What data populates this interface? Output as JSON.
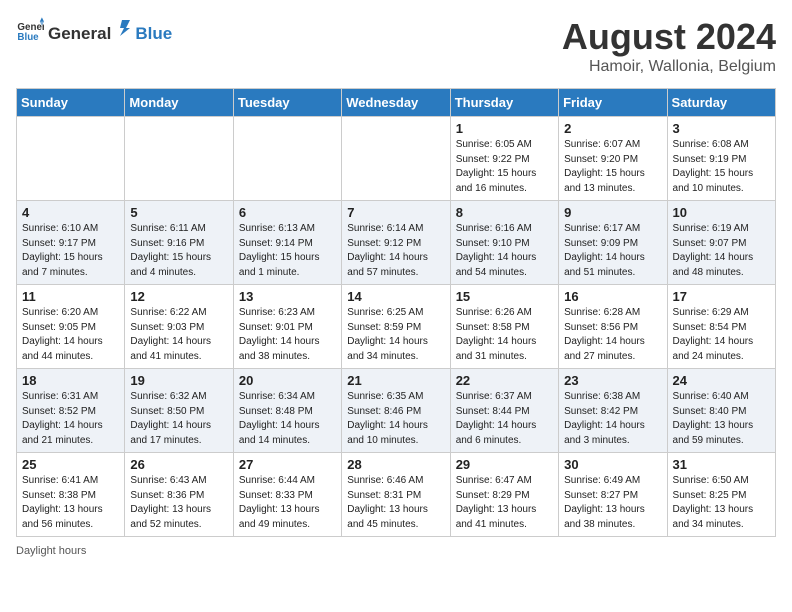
{
  "header": {
    "logo_general": "General",
    "logo_blue": "Blue",
    "title": "August 2024",
    "subtitle": "Hamoir, Wallonia, Belgium"
  },
  "columns": [
    "Sunday",
    "Monday",
    "Tuesday",
    "Wednesday",
    "Thursday",
    "Friday",
    "Saturday"
  ],
  "rows": [
    [
      {
        "day": "",
        "info": ""
      },
      {
        "day": "",
        "info": ""
      },
      {
        "day": "",
        "info": ""
      },
      {
        "day": "",
        "info": ""
      },
      {
        "day": "1",
        "info": "Sunrise: 6:05 AM\nSunset: 9:22 PM\nDaylight: 15 hours and 16 minutes."
      },
      {
        "day": "2",
        "info": "Sunrise: 6:07 AM\nSunset: 9:20 PM\nDaylight: 15 hours and 13 minutes."
      },
      {
        "day": "3",
        "info": "Sunrise: 6:08 AM\nSunset: 9:19 PM\nDaylight: 15 hours and 10 minutes."
      }
    ],
    [
      {
        "day": "4",
        "info": "Sunrise: 6:10 AM\nSunset: 9:17 PM\nDaylight: 15 hours and 7 minutes."
      },
      {
        "day": "5",
        "info": "Sunrise: 6:11 AM\nSunset: 9:16 PM\nDaylight: 15 hours and 4 minutes."
      },
      {
        "day": "6",
        "info": "Sunrise: 6:13 AM\nSunset: 9:14 PM\nDaylight: 15 hours and 1 minute."
      },
      {
        "day": "7",
        "info": "Sunrise: 6:14 AM\nSunset: 9:12 PM\nDaylight: 14 hours and 57 minutes."
      },
      {
        "day": "8",
        "info": "Sunrise: 6:16 AM\nSunset: 9:10 PM\nDaylight: 14 hours and 54 minutes."
      },
      {
        "day": "9",
        "info": "Sunrise: 6:17 AM\nSunset: 9:09 PM\nDaylight: 14 hours and 51 minutes."
      },
      {
        "day": "10",
        "info": "Sunrise: 6:19 AM\nSunset: 9:07 PM\nDaylight: 14 hours and 48 minutes."
      }
    ],
    [
      {
        "day": "11",
        "info": "Sunrise: 6:20 AM\nSunset: 9:05 PM\nDaylight: 14 hours and 44 minutes."
      },
      {
        "day": "12",
        "info": "Sunrise: 6:22 AM\nSunset: 9:03 PM\nDaylight: 14 hours and 41 minutes."
      },
      {
        "day": "13",
        "info": "Sunrise: 6:23 AM\nSunset: 9:01 PM\nDaylight: 14 hours and 38 minutes."
      },
      {
        "day": "14",
        "info": "Sunrise: 6:25 AM\nSunset: 8:59 PM\nDaylight: 14 hours and 34 minutes."
      },
      {
        "day": "15",
        "info": "Sunrise: 6:26 AM\nSunset: 8:58 PM\nDaylight: 14 hours and 31 minutes."
      },
      {
        "day": "16",
        "info": "Sunrise: 6:28 AM\nSunset: 8:56 PM\nDaylight: 14 hours and 27 minutes."
      },
      {
        "day": "17",
        "info": "Sunrise: 6:29 AM\nSunset: 8:54 PM\nDaylight: 14 hours and 24 minutes."
      }
    ],
    [
      {
        "day": "18",
        "info": "Sunrise: 6:31 AM\nSunset: 8:52 PM\nDaylight: 14 hours and 21 minutes."
      },
      {
        "day": "19",
        "info": "Sunrise: 6:32 AM\nSunset: 8:50 PM\nDaylight: 14 hours and 17 minutes."
      },
      {
        "day": "20",
        "info": "Sunrise: 6:34 AM\nSunset: 8:48 PM\nDaylight: 14 hours and 14 minutes."
      },
      {
        "day": "21",
        "info": "Sunrise: 6:35 AM\nSunset: 8:46 PM\nDaylight: 14 hours and 10 minutes."
      },
      {
        "day": "22",
        "info": "Sunrise: 6:37 AM\nSunset: 8:44 PM\nDaylight: 14 hours and 6 minutes."
      },
      {
        "day": "23",
        "info": "Sunrise: 6:38 AM\nSunset: 8:42 PM\nDaylight: 14 hours and 3 minutes."
      },
      {
        "day": "24",
        "info": "Sunrise: 6:40 AM\nSunset: 8:40 PM\nDaylight: 13 hours and 59 minutes."
      }
    ],
    [
      {
        "day": "25",
        "info": "Sunrise: 6:41 AM\nSunset: 8:38 PM\nDaylight: 13 hours and 56 minutes."
      },
      {
        "day": "26",
        "info": "Sunrise: 6:43 AM\nSunset: 8:36 PM\nDaylight: 13 hours and 52 minutes."
      },
      {
        "day": "27",
        "info": "Sunrise: 6:44 AM\nSunset: 8:33 PM\nDaylight: 13 hours and 49 minutes."
      },
      {
        "day": "28",
        "info": "Sunrise: 6:46 AM\nSunset: 8:31 PM\nDaylight: 13 hours and 45 minutes."
      },
      {
        "day": "29",
        "info": "Sunrise: 6:47 AM\nSunset: 8:29 PM\nDaylight: 13 hours and 41 minutes."
      },
      {
        "day": "30",
        "info": "Sunrise: 6:49 AM\nSunset: 8:27 PM\nDaylight: 13 hours and 38 minutes."
      },
      {
        "day": "31",
        "info": "Sunrise: 6:50 AM\nSunset: 8:25 PM\nDaylight: 13 hours and 34 minutes."
      }
    ]
  ],
  "footer": "Daylight hours"
}
